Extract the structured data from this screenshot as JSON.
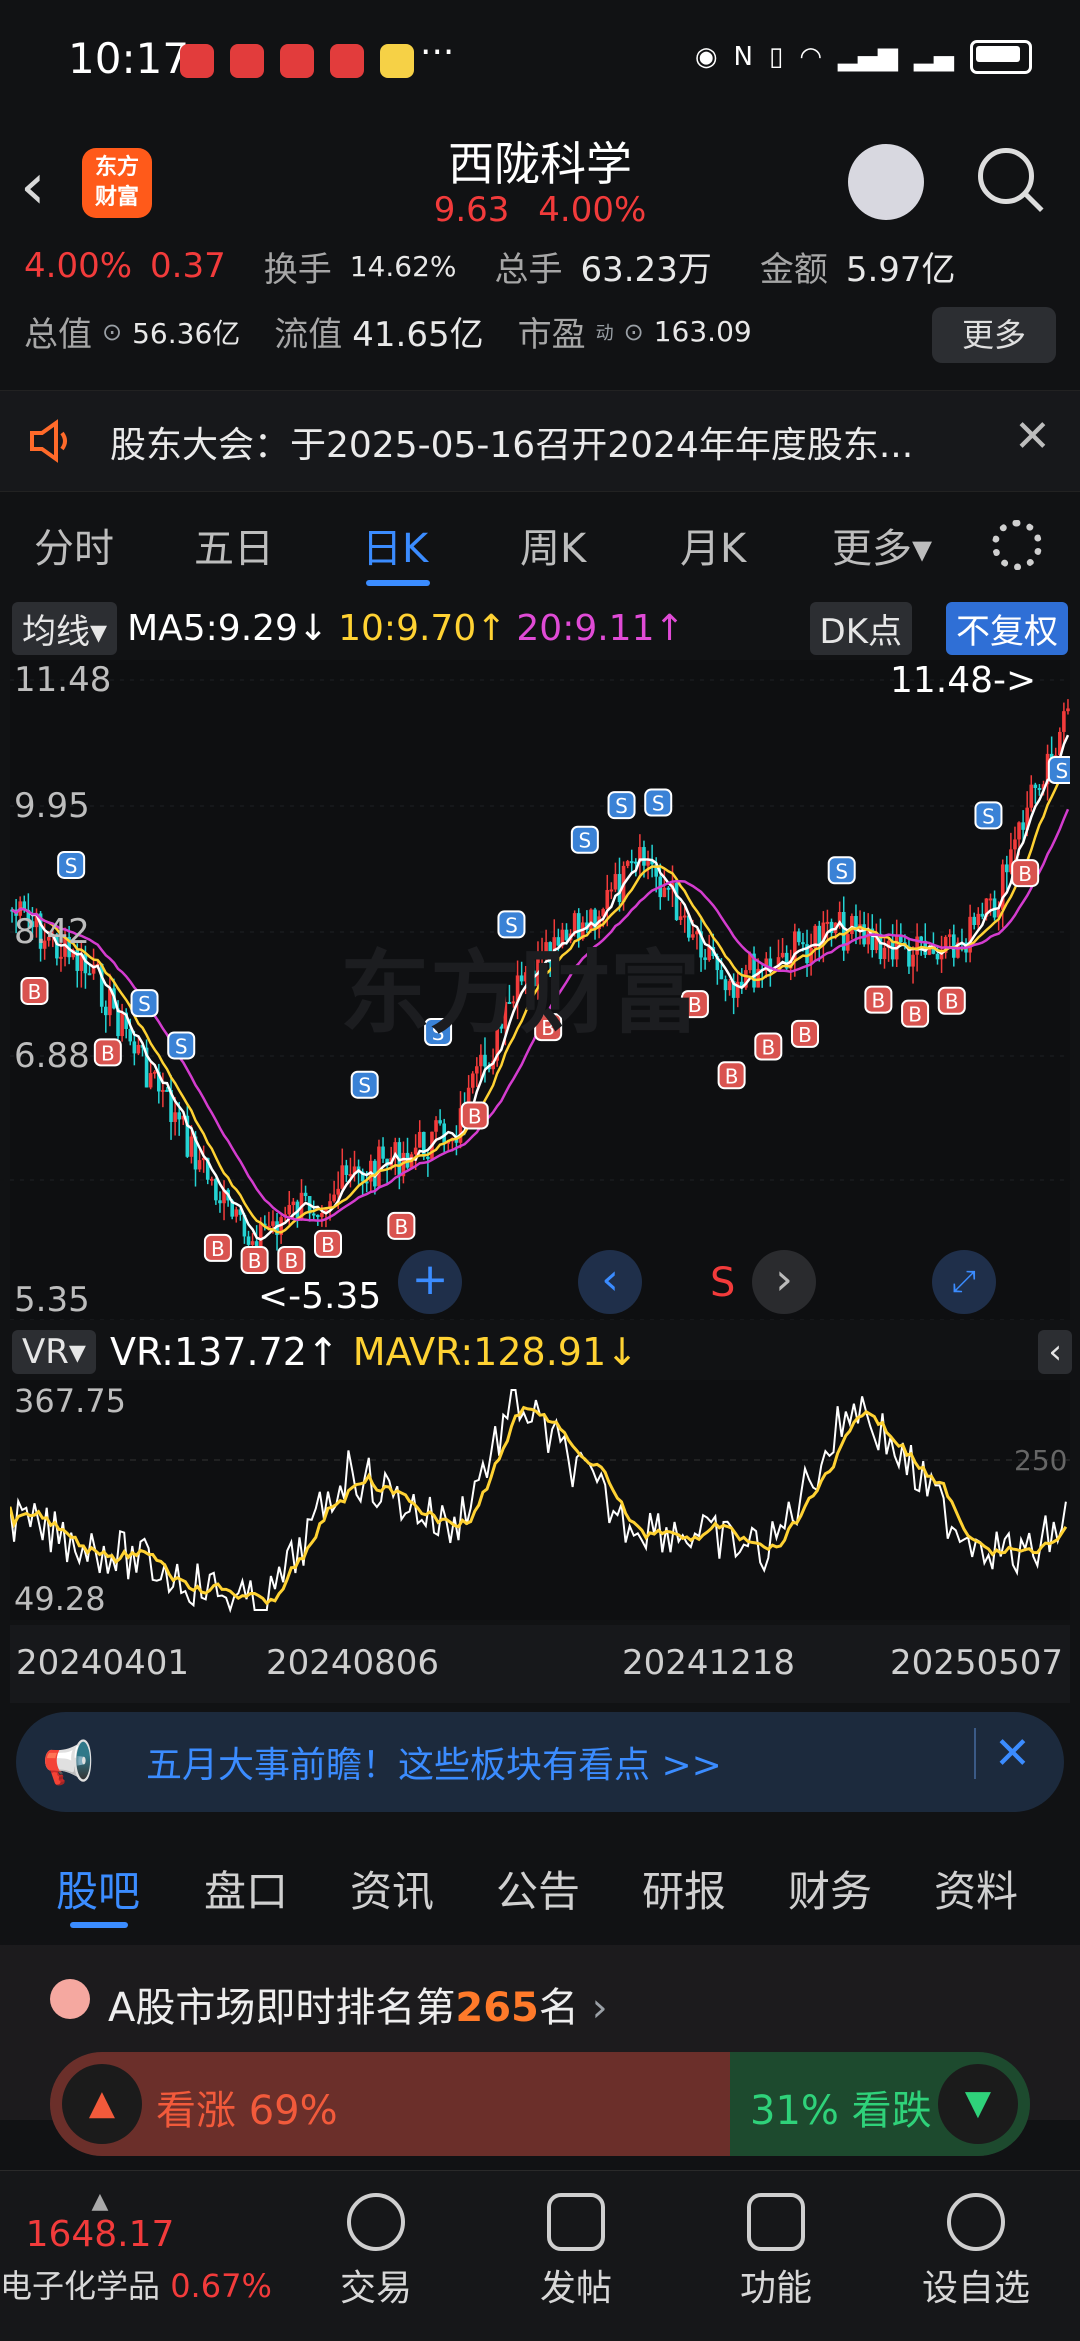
{
  "status_bar": {
    "time": "10:17",
    "more": "···"
  },
  "header": {
    "back_icon": "chevron-left-icon",
    "logo_text": "东方\n财富",
    "stock_name": "西陇科学",
    "price": "9.63",
    "change_pct": "4.00%"
  },
  "stats": {
    "row1": {
      "pct": "4.00%",
      "chg": "0.37",
      "turnover_label": "换手",
      "turnover": "14.62%",
      "volume_label": "总手",
      "volume": "63.23万",
      "amount_label": "金额",
      "amount": "5.97亿"
    },
    "row2": {
      "mktcap_label": "总值",
      "mktcap": "56.36亿",
      "float_label": "流值",
      "float": "41.65亿",
      "pe_label": "市盈",
      "pe_sup": "动",
      "pe": "163.09"
    },
    "more_button": "更多"
  },
  "notice": {
    "text": "股东大会：于2025-05-16召开2024年年度股东..."
  },
  "tabs": [
    "分时",
    "五日",
    "日K",
    "周K",
    "月K",
    "更多▾"
  ],
  "active_tab": "日K",
  "chart_header": {
    "ma_select": "均线▾",
    "ma5": "MA5:9.29↓",
    "ma10": "10:9.70↑",
    "ma20": "20:9.11↑",
    "dk_button": "DK点",
    "adjust_button": "不复权"
  },
  "kline": {
    "price_labels": [
      "11.48",
      "9.95",
      "8.42",
      "6.88",
      "5.35"
    ],
    "high_marker": "11.48->",
    "low_marker": "<-5.35",
    "watermark": "东方财富",
    "nav_s_label": "S"
  },
  "vr_header": {
    "select": "VR▾",
    "vr": "VR:137.72↑",
    "mavr": "MAVR:128.91↓",
    "collapse_icon": "chevron-left-icon"
  },
  "vr_chart": {
    "top": "367.75",
    "bottom": "49.28",
    "mid": "250"
  },
  "dates": [
    "20240401",
    "20240806",
    "20241218",
    "20250507"
  ],
  "banner": {
    "text": "五月大事前瞻！这些板块有看点 >>"
  },
  "sub_tabs": [
    "股吧",
    "盘口",
    "资讯",
    "公告",
    "研报",
    "财务",
    "资料"
  ],
  "active_sub_tab": "股吧",
  "ranking": {
    "prefix": "A股市场即时排名第",
    "rank": "265",
    "suffix": "名",
    "bull": "看涨 69%",
    "bear": "31% 看跌"
  },
  "bottom_nav": {
    "index_value": "1648.17",
    "index_name": "电子化学品",
    "index_change": "0.67%",
    "items": [
      "交易",
      "发帖",
      "功能",
      "设自选"
    ]
  },
  "colors": {
    "up": "#f23b3b",
    "down": "#24c76a",
    "accent": "#3b8cff",
    "ma5": "#ffffff",
    "ma10": "#ffd233",
    "ma20": "#e04bd6"
  }
}
